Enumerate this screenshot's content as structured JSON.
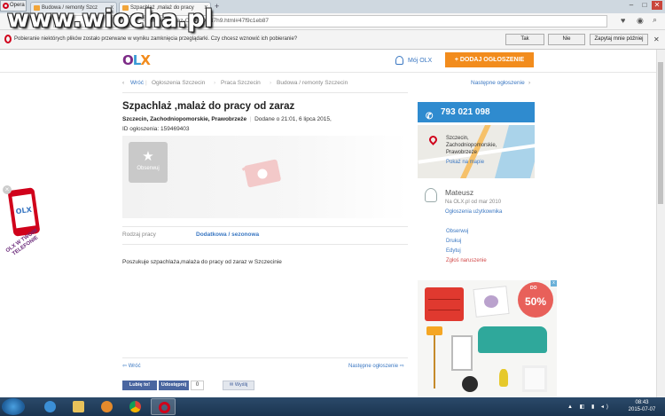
{
  "watermark": "www.wiocha.pl",
  "browser": {
    "menu_label": "Opera",
    "tabs": [
      {
        "label": "Budowa / remonty Szcz",
        "active": false
      },
      {
        "label": "Szpachlaż ,malaż do pracy",
        "active": true
      }
    ],
    "new_tab": "+",
    "tab_close": "x",
    "url": "-procy-od-zaraz-CID4-IDaN7h9.html#47f9c1eb87",
    "win_controls": [
      "–",
      "□",
      "✕"
    ]
  },
  "notification": {
    "message": "Pobieranie niektórych plików zostało przerwane w wyniku zamknięcia przeglądarki. Czy chcesz wznowić ich pobieranie?",
    "yes": "Tak",
    "no": "Nie",
    "later": "Zapytaj mnie później"
  },
  "header": {
    "logo_o": "O",
    "logo_l": "L",
    "logo_x": "X",
    "my_olx": "Mój OLX",
    "add_ad": "+ DODAJ OGŁOSZENIE"
  },
  "breadcrumb": {
    "back": "Wróć",
    "items": [
      "Ogłoszenia Szczecin",
      "Praca Szczecin",
      "Budowa / remonty Szczecin"
    ],
    "next": "Następne ogłoszenie"
  },
  "listing": {
    "title": "Szpachlaż ,malaż do pracy od zaraz",
    "location": "Szczecin, Zachodniopomorskie, Prawobrzeże",
    "added": "Dodane o 21:01, 6 lipca 2015,",
    "ad_id": "ID ogłoszenia: 159469403",
    "observe": "Obserwuj",
    "param_label": "Rodzaj pracy",
    "param_value": "Dodatkowa / sezonowa",
    "description": "Poszukuje szpachlaża,malaża do pracy od zaraz w Szczecinie",
    "prev": "Wróć",
    "next": "Następne ogłoszenie"
  },
  "social": {
    "like": "Lubię to!",
    "share": "Udostępnij",
    "count": "0",
    "send": "Wyślij"
  },
  "sidebar": {
    "phone": "793 021 098",
    "map_location": [
      "Szczecin,",
      "Zachodniopomorskie,",
      "Prawobrzeże"
    ],
    "show_on_map": "Pokaż na mapie",
    "user_name": "Mateusz",
    "user_since": "Na OLX.pl od mar 2010",
    "user_ads": "Ogłoszenia użytkownika",
    "links": [
      "Obserwuj",
      "Drukuj",
      "Edytuj",
      "Zgłoś naruszenie"
    ]
  },
  "ad_banner": {
    "sale_top": "DO",
    "sale": "50%",
    "close": "x"
  },
  "phone_ad": {
    "logo": "OLX",
    "slogan": "OLX W TWOIM TELEFONIE",
    "close": "×"
  },
  "taskbar": {
    "time": "08:43",
    "date": "2015-07-07"
  },
  "colors": {
    "accent_blue": "#2f8bcf",
    "add_orange": "#f28c1d",
    "link_blue": "#3a77c2"
  }
}
